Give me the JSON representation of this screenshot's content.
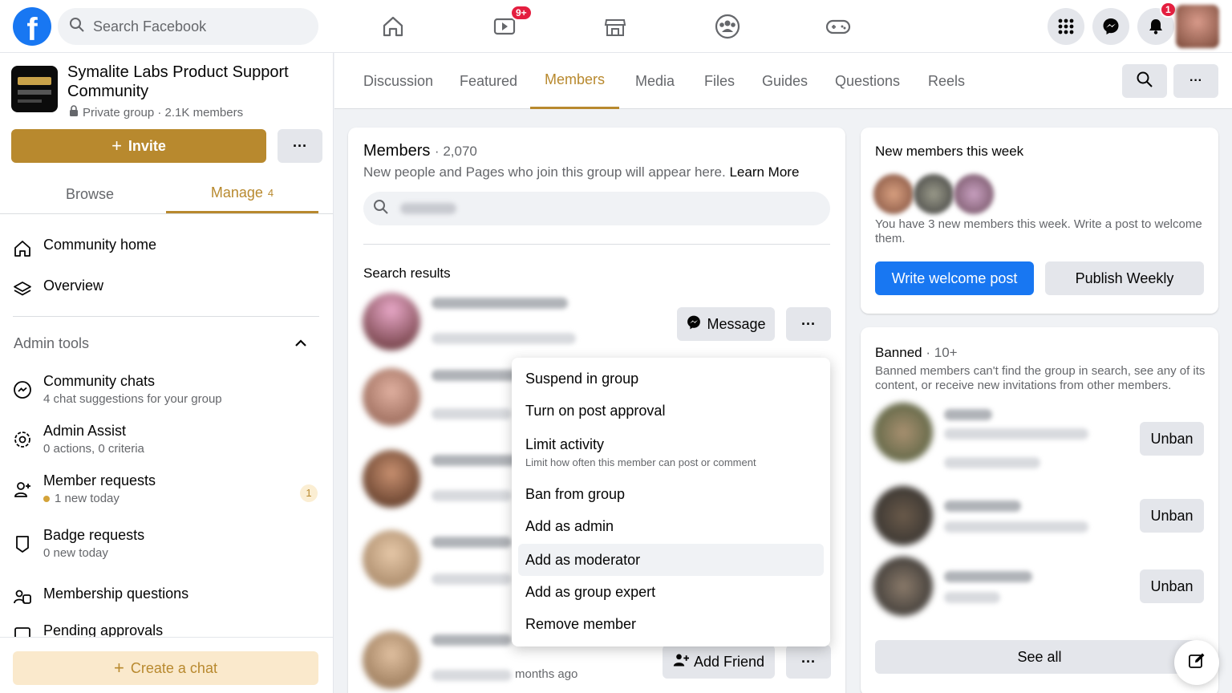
{
  "topbar": {
    "search_placeholder": "Search Facebook",
    "video_badge": "9+",
    "notifications_badge": "1",
    "nav_icons": [
      "home-icon",
      "video-icon",
      "marketplace-icon",
      "groups-icon",
      "gaming-icon"
    ],
    "accent_color": "#1877f2"
  },
  "group": {
    "name": "Symalite Labs Product Support Community",
    "meta": "Private group · 2.1K members",
    "invite_label": "Invite",
    "browse_label": "Browse",
    "manage_label": "Manage",
    "manage_count": "4",
    "brand_color": "#b8892e"
  },
  "sidebar": {
    "community_home": "Community home",
    "overview": "Overview",
    "admin_tools_label": "Admin tools",
    "items": [
      {
        "label": "Community chats",
        "sub": "4 chat suggestions for your group"
      },
      {
        "label": "Admin Assist",
        "sub": "0 actions, 0 criteria"
      },
      {
        "label": "Member requests",
        "sub": "1 new today",
        "count": "1"
      },
      {
        "label": "Badge requests",
        "sub": "0 new today"
      },
      {
        "label": "Membership questions",
        "sub": ""
      },
      {
        "label": "Pending approvals",
        "sub": ""
      }
    ],
    "create_chat": "Create a chat"
  },
  "tabs": [
    "Discussion",
    "Featured",
    "Members",
    "Media",
    "Files",
    "Guides",
    "Questions",
    "Reels"
  ],
  "members": {
    "title": "Members",
    "count": "2,070",
    "desc": "New people and Pages who join this group will appear here.",
    "learn_more": "Learn More",
    "search_results": "Search results",
    "message_label": "Message",
    "add_friend_label": "Add Friend",
    "months_ago": "months ago"
  },
  "dropdown": {
    "items": [
      {
        "label": "Suspend in group",
        "sub": ""
      },
      {
        "label": "Turn on post approval",
        "sub": ""
      },
      {
        "label": "Limit activity",
        "sub": "Limit how often this member can post or comment"
      },
      {
        "label": "Ban from group",
        "sub": ""
      },
      {
        "label": "Add as admin",
        "sub": ""
      },
      {
        "label": "Add as moderator",
        "sub": ""
      },
      {
        "label": "Add as group expert",
        "sub": ""
      },
      {
        "label": "Remove member",
        "sub": ""
      }
    ]
  },
  "new_members": {
    "title": "New members this week",
    "text": "You have 3 new members this week. Write a post to welcome them.",
    "write_post": "Write welcome post",
    "publish_weekly": "Publish Weekly"
  },
  "banned": {
    "title": "Banned",
    "count": "10+",
    "text": "Banned members can't find the group in search, see any of its content, or receive new invitations from other members.",
    "unban_label": "Unban",
    "see_all": "See all"
  }
}
